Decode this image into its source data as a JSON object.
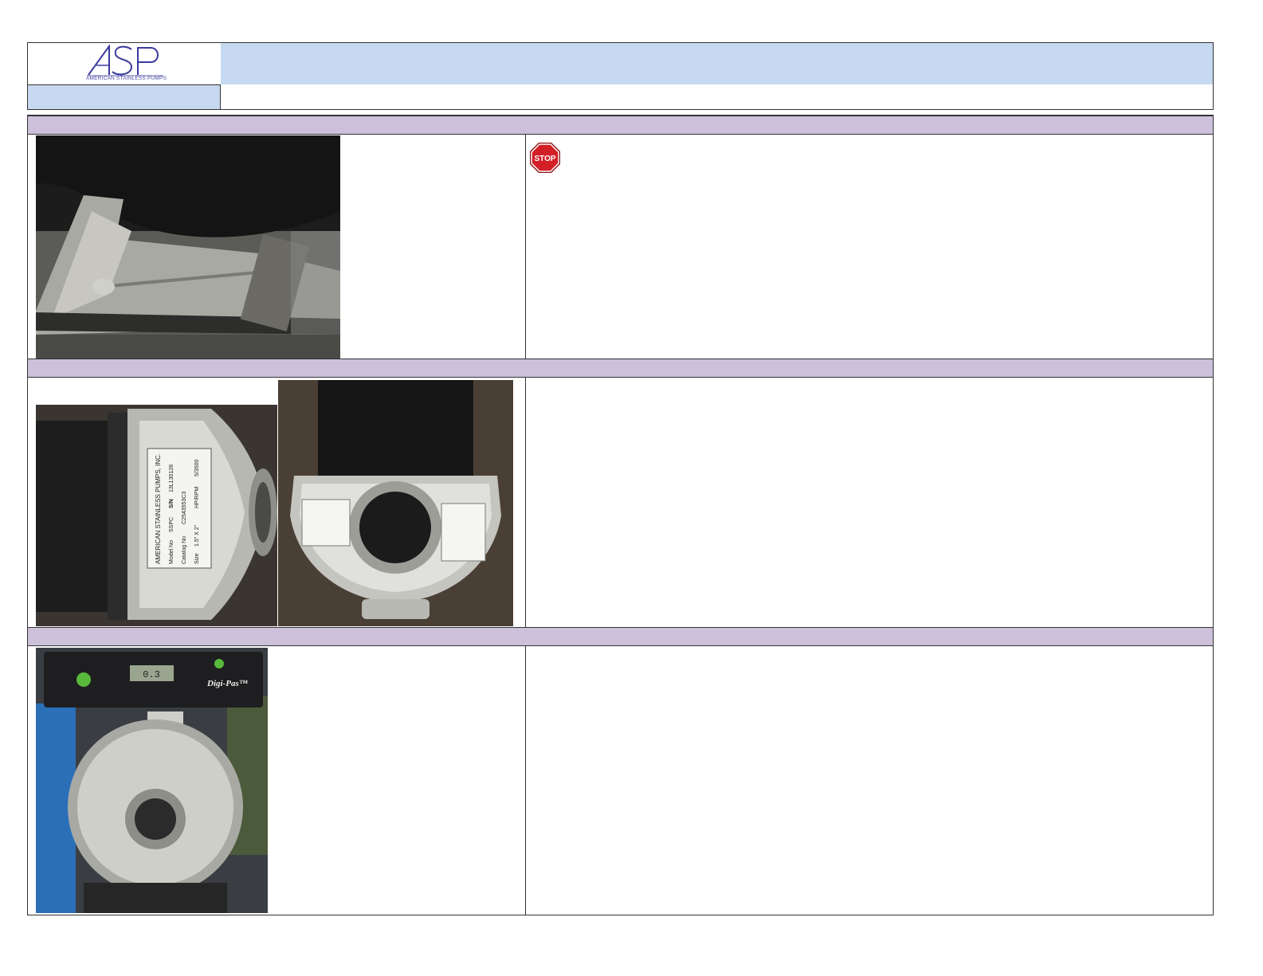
{
  "header": {
    "logo_text": "ASP",
    "logo_tagline": "American Stainless Pumps",
    "title": "",
    "subtitle_label": "",
    "subtitle_value": ""
  },
  "sections": [
    {
      "left_heading": "",
      "right_heading": "",
      "right_body": ""
    },
    {
      "left_heading": "",
      "right_heading": "",
      "right_body": ""
    },
    {
      "left_heading": "",
      "right_heading": "",
      "right_body": ""
    }
  ],
  "stop_sign": {
    "text": "STOP",
    "color": "#d32027"
  },
  "nameplate": {
    "company": "AMERICAN STAINLESS PUMPS, INC.",
    "model_no_label": "Model No",
    "model_no": "SSPC",
    "sn_label": "S/N",
    "sn": "13L130128",
    "catalog_label": "Catalog No",
    "catalog": "C2543553C3",
    "size_label": "Size",
    "size": "1.5\" X 2\"",
    "hp_rpm_label": "HP/RPM",
    "hp_rpm": "5/3500"
  },
  "level_gauge": {
    "brand": "Digi-Pas™",
    "reading": "0.3"
  },
  "colors": {
    "header_blue": "#c6d9f0",
    "section_lilac": "#ccc0da",
    "logo_purple": "#3a3a9c"
  }
}
